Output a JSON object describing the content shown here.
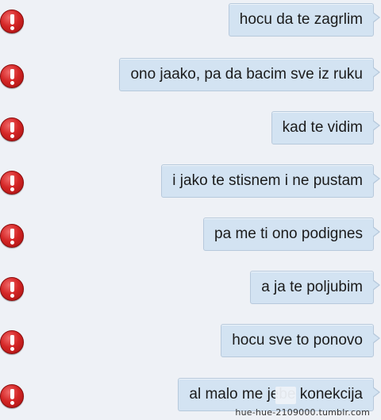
{
  "messages": [
    {
      "text": "hocu da te zagrlim",
      "status": "failed"
    },
    {
      "text": "ono jaako, pa da bacim sve iz ruku",
      "status": "failed"
    },
    {
      "text": "kad te vidim",
      "status": "failed"
    },
    {
      "text": "i jako te stisnem i ne pustam",
      "status": "failed"
    },
    {
      "text": "pa me ti ono podignes",
      "status": "failed"
    },
    {
      "text": "a ja te poljubim",
      "status": "failed"
    },
    {
      "text": "hocu sve to ponovo",
      "status": "failed"
    },
    {
      "text": "al malo me jebe konekcija",
      "status": "failed"
    }
  ],
  "watermark": "hue-hue-2109000.tumblr.com",
  "colors": {
    "background": "#eef1f6",
    "bubble": "#d3e3f2",
    "error_icon": "#d42626"
  },
  "icons": {
    "error": "error-exclamation-icon"
  }
}
